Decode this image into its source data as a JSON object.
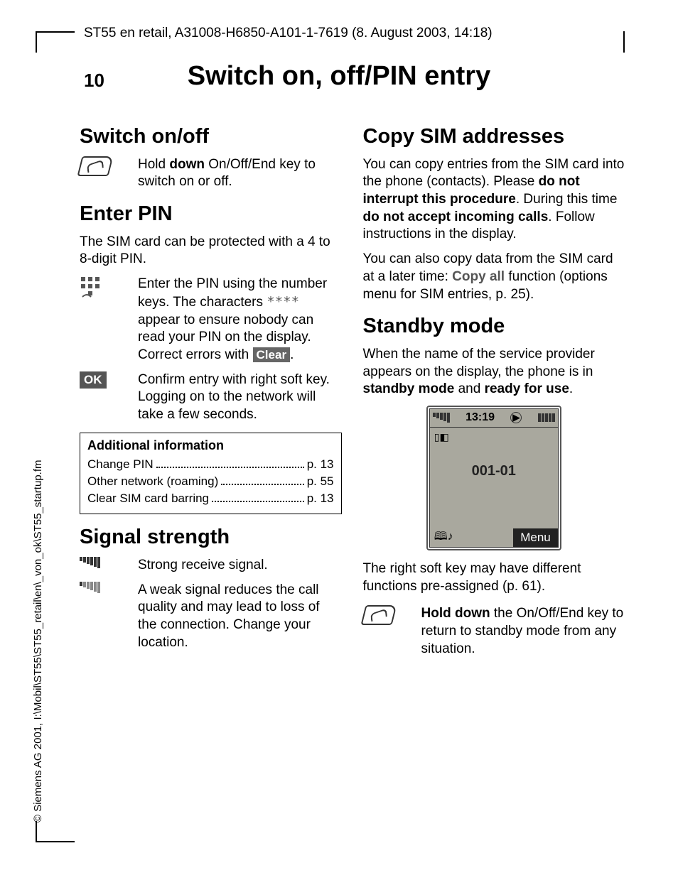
{
  "header": "ST55 en retail, A31008-H6850-A101-1-7619 (8. August 2003, 14:18)",
  "page_number": "10",
  "chapter_title": "Switch on, off/PIN entry",
  "sidebar": "© Siemens AG 2001, I:\\Mobil\\ST55\\ST55_retail\\en\\_von_ok\\ST55_startup.fm",
  "left": {
    "h_switch": "Switch on/off",
    "switch_text_pre": "Hold ",
    "switch_bold": "down",
    "switch_text_post": " On/Off/End key to switch on or off.",
    "h_enter": "Enter PIN",
    "enter_intro": "The SIM card can be protected with a 4 to 8-digit PIN.",
    "keypad_icon": "keypad-icon",
    "enter_pin_pre": "Enter the PIN using the number keys. The characters ",
    "enter_asterisks": "****",
    "enter_pin_mid": " appear to ensure nobody can read your PIN on the display. Correct errors with ",
    "clear_label": "Clear",
    "enter_pin_end": ".",
    "ok_label": "OK",
    "ok_text": "Confirm entry with right soft key. Logging on to the network will take a few seconds.",
    "addl_title": "Additional information",
    "addl_rows": [
      {
        "label": "Change PIN",
        "page": "p. 13"
      },
      {
        "label": "Other network (roaming)",
        "page": "p. 55"
      },
      {
        "label": "Clear SIM card barring",
        "page": "p. 13"
      }
    ],
    "h_signal": "Signal strength",
    "signal_strong": "Strong receive signal.",
    "signal_weak": "A weak signal reduces the call quality and may lead to loss of the connection. Change your location."
  },
  "right": {
    "h_copy": "Copy SIM addresses",
    "copy_p1a": "You can copy entries from the SIM card into the phone (contacts). Please ",
    "copy_p1b": "do not interrupt this procedure",
    "copy_p1c": ". During this time ",
    "copy_p1d": "do not accept incoming calls",
    "copy_p1e": ". Follow instructions in the display.",
    "copy_p2a": "You can also copy data from the SIM card at a later time: ",
    "copy_all": "Copy all",
    "copy_p2b": " function (options menu for SIM entries, p. 25).",
    "h_standby": "Standby mode",
    "standby_p1a": "When the name of the service provider appears on the display, the phone is in ",
    "standby_b1": "standby mode",
    "standby_mid": " and ",
    "standby_b2": "ready for use",
    "standby_end": ".",
    "phone": {
      "time": "13:19",
      "network": "001-01",
      "menu": "Menu"
    },
    "softkey_note": "The right soft key may have different functions pre-assigned (p. 61).",
    "holddown_b": "Hold down",
    "holddown_text": " the On/Off/End key to return to standby mode from any situation."
  }
}
